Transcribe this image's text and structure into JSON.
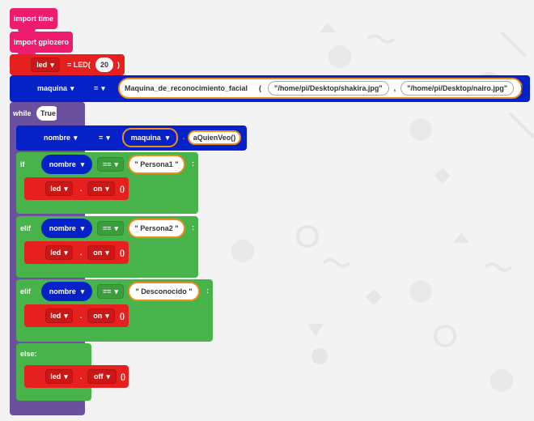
{
  "colors": {
    "import": "#ed1c6f",
    "io": "#e61f1f",
    "variable": "#0521c8",
    "logic": "#47b34a",
    "loop": "#6b509e",
    "highlight": "#f08c1a"
  },
  "blocks": {
    "import_time": "import time",
    "import_gpiozero": "import gpiozero",
    "led_assign": {
      "var": "led",
      "op": "= LED(",
      "pin": "20",
      "close": ")"
    },
    "maquina_assign": {
      "var": "maquina",
      "op": "=",
      "call": "Maquina_de_reconocimiento_facial",
      "open": "(",
      "arg1": "\"/home/pi/Desktop/shakira.jpg\"",
      "sep": ",",
      "arg2": "\"/home/pi/Desktop/nairo.jpg\"",
      "close": ")"
    },
    "while": {
      "keyword": "while",
      "cond": "True",
      "colon": ":"
    },
    "nombre_assign": {
      "var": "nombre",
      "op": "=",
      "obj": "maquina",
      "dot": ".",
      "method": "aQuienVeo()"
    },
    "if": {
      "keyword": "if",
      "var": "nombre",
      "op": "==",
      "value": "\" Persona1 \"",
      "colon": ":",
      "led": "led",
      "dot": ".",
      "action": "on",
      "parens": "()"
    },
    "elif1": {
      "keyword": "elif",
      "var": "nombre",
      "op": "==",
      "value": "\" Persona2 \"",
      "colon": ":",
      "led": "led",
      "dot": ".",
      "action": "on",
      "parens": "()"
    },
    "elif2": {
      "keyword": "elif",
      "var": "nombre",
      "op": "==",
      "value": "\" Desconocido \"",
      "colon": ":",
      "led": "led",
      "dot": ".",
      "action": "on",
      "parens": "()"
    },
    "else": {
      "keyword": "else:",
      "led": "led",
      "dot": ".",
      "action": "off",
      "parens": "()"
    }
  }
}
